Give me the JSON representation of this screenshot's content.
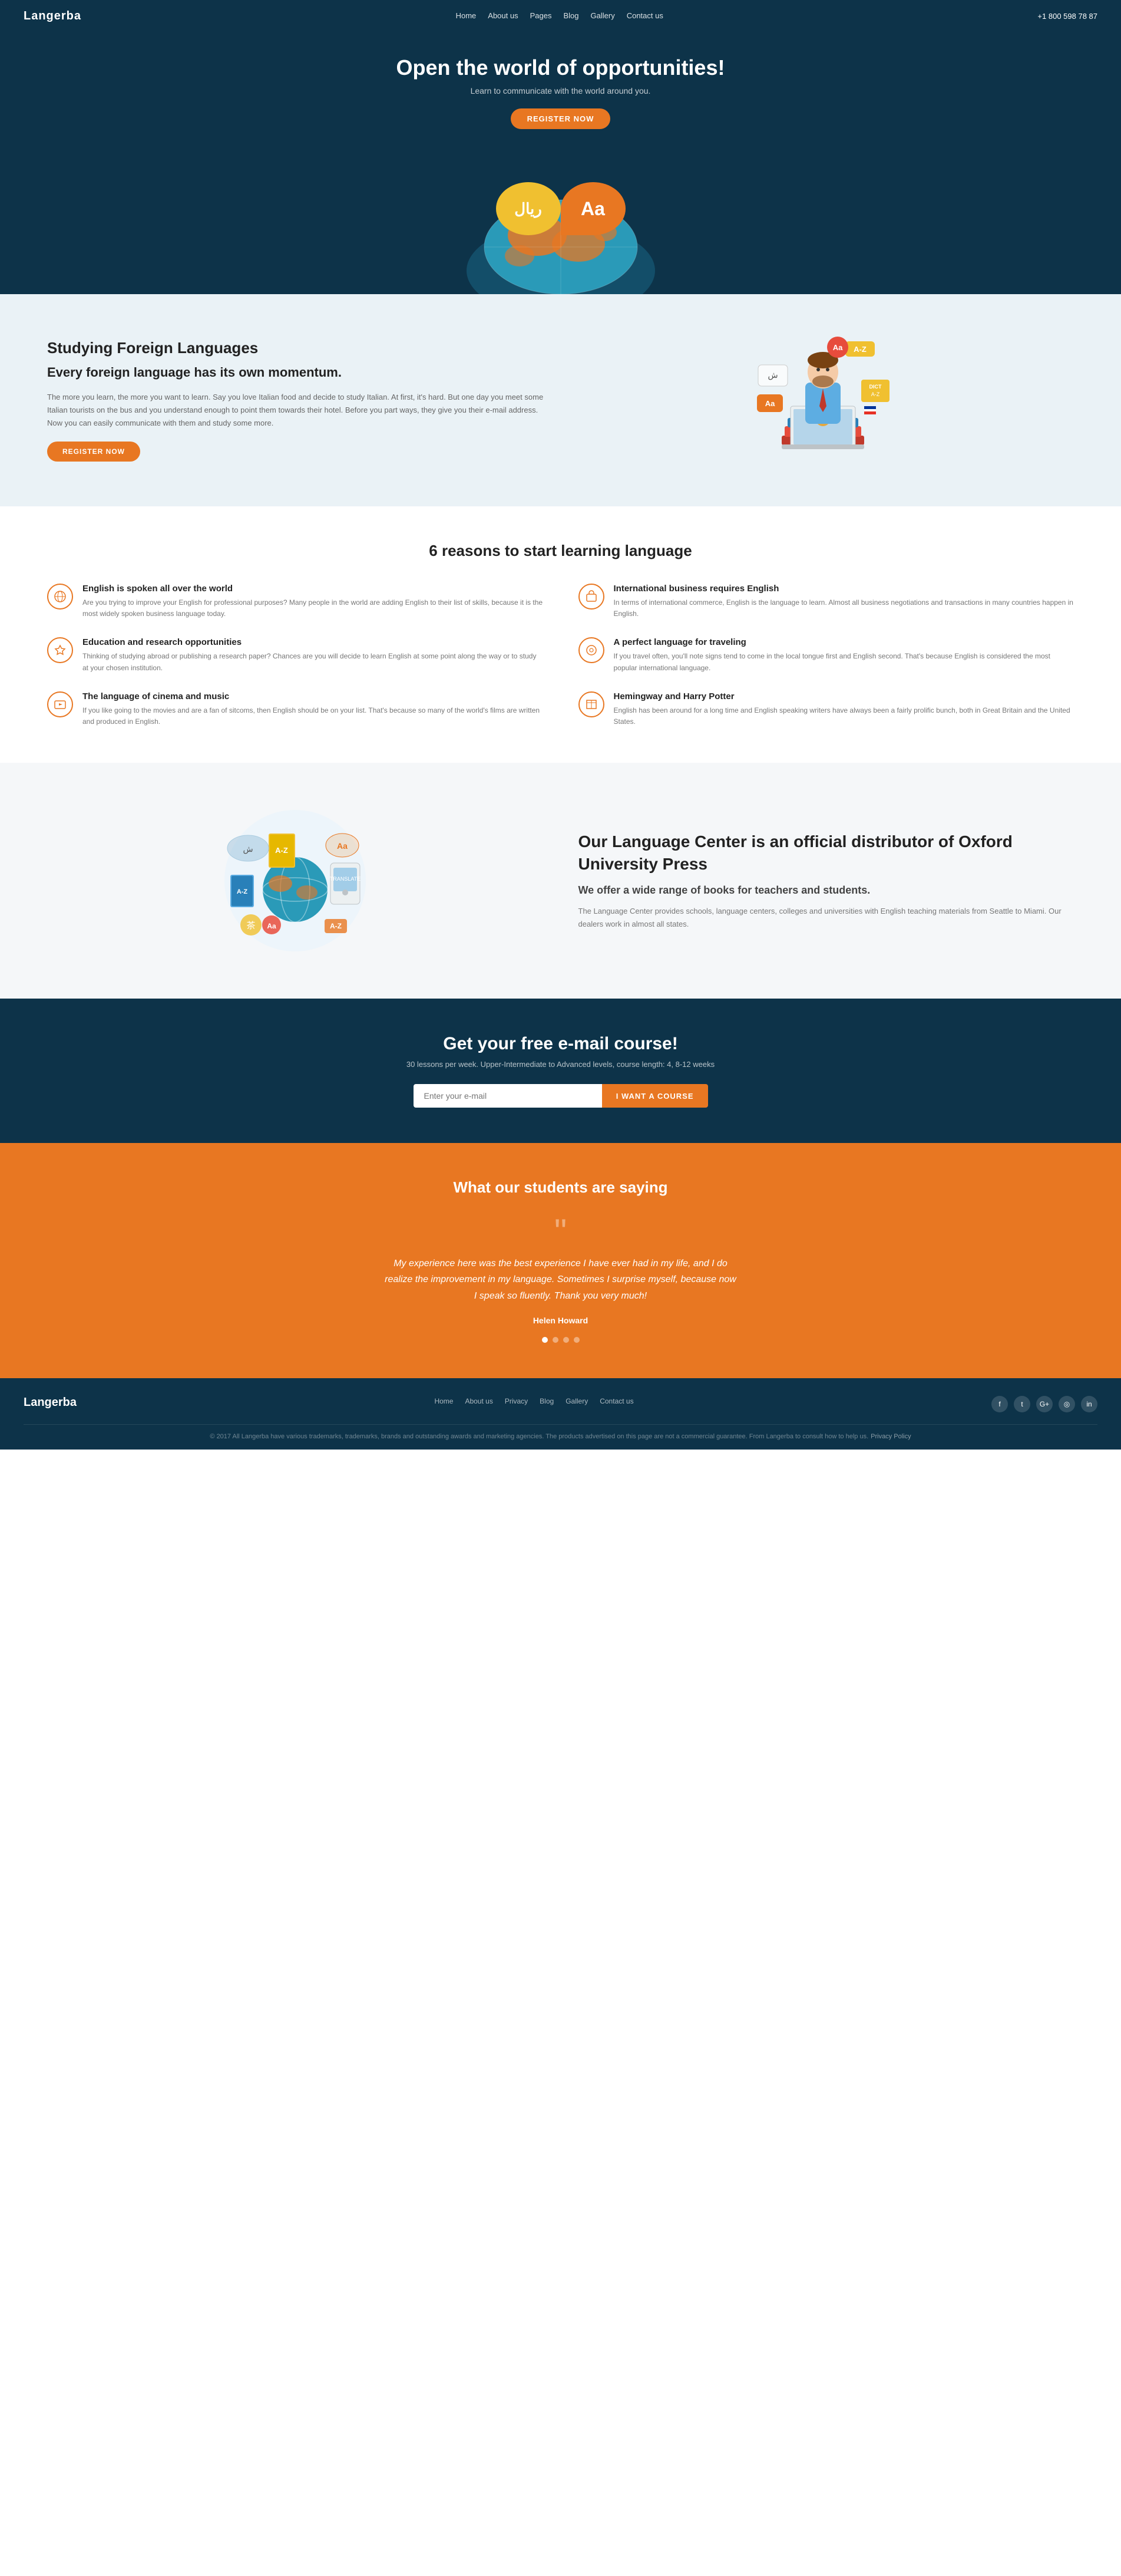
{
  "nav": {
    "logo": "Langerba",
    "links": [
      "Home",
      "About us",
      "Pages",
      "Blog",
      "Gallery",
      "Contact us"
    ],
    "phone": "+1 800 598 78 87"
  },
  "hero": {
    "title": "Open the world of opportunities!",
    "subtitle": "Learn to communicate with the world around you.",
    "cta_button": "REGISTER NOW"
  },
  "study_section": {
    "heading": "Studying Foreign Languages",
    "subheading": "Every foreign language has its own momentum.",
    "body": "The more you learn, the more you want to learn. Say you love Italian food and decide to study Italian. At first, it's hard. But one day you meet some Italian tourists on the bus and you understand enough to point them towards their hotel. Before you part ways, they give you their e-mail address. Now you can easily communicate with them and study some more.",
    "button": "REGISTER NOW"
  },
  "reasons_section": {
    "heading": "6 reasons to start learning language",
    "reasons": [
      {
        "icon": "🌐",
        "title": "English is spoken all over the world",
        "description": "Are you trying to improve your English for professional purposes? Many people in the world are adding English to their list of skills, because it is the most widely spoken business language today."
      },
      {
        "icon": "💼",
        "title": "International business requires English",
        "description": "In terms of international commerce, English is the language to learn. Almost all business negotiations and transactions in many countries happen in English."
      },
      {
        "icon": "🎓",
        "title": "Education and research opportunities",
        "description": "Thinking of studying abroad or publishing a research paper? Chances are you will decide to learn English at some point along the way or to study at your chosen institution."
      },
      {
        "icon": "✈️",
        "title": "A perfect language for traveling",
        "description": "If you travel often, you'll note signs tend to come in the local tongue first and English second. That's because English is considered the most popular international language."
      },
      {
        "icon": "🎬",
        "title": "The language of cinema and music",
        "description": "If you like going to the movies and are a fan of sitcoms, then English should be on your list. That's because so many of the world's films are written and produced in English."
      },
      {
        "icon": "📖",
        "title": "Hemingway and Harry Potter",
        "description": "English has been around for a long time and English speaking writers have always been a fairly prolific bunch, both in Great Britain and the United States."
      }
    ]
  },
  "oxford_section": {
    "heading": "Our Language Center is an official distributor of Oxford University Press",
    "subheading": "We offer a wide range of books for teachers and students.",
    "body": "The Language Center provides schools, language centers, colleges and universities with English teaching materials from Seattle to Miami. Our dealers work in almost all states."
  },
  "email_section": {
    "heading": "Get your free e-mail course!",
    "subtitle": "30 lessons per week. Upper-Intermediate to Advanced levels, course length: 4, 8-12 weeks",
    "input_placeholder": "Enter your e-mail",
    "button": "I WANT A COURSE"
  },
  "testimonials_section": {
    "heading": "What our students are saying",
    "quote": "My experience here was the best experience I have ever had in my life, and I do realize the improvement in my language. Sometimes I surprise myself, because now I speak so fluently. Thank you very much!",
    "author": "Helen Howard",
    "dots": [
      true,
      false,
      false,
      false
    ]
  },
  "footer": {
    "logo": "Langerba",
    "links": [
      "Home",
      "About us",
      "Privacy",
      "Blog",
      "Gallery",
      "Contact us"
    ],
    "social_icons": [
      "f",
      "t",
      "G+",
      "in",
      "in"
    ],
    "copyright": "© 2017 All Langerba have various trademarks, trademarks, brands and outstanding awards and marketing agencies. The products advertised on this page are not a commercial guarantee. From Langerba to consult how to help us.",
    "privacy_link": "Privacy Policy"
  }
}
